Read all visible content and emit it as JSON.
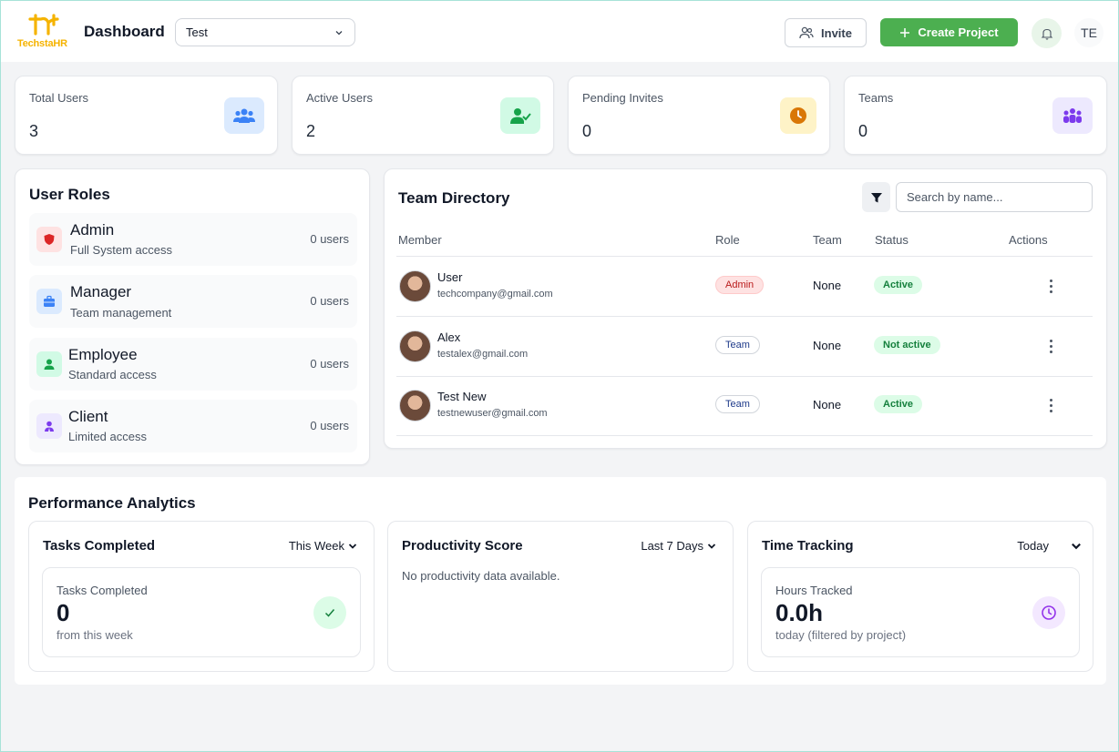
{
  "header": {
    "logo_text": "TechstaHR",
    "title": "Dashboard",
    "project_select": "Test",
    "invite_label": "Invite",
    "create_label": "Create Project",
    "avatar_initials": "TE"
  },
  "stats": [
    {
      "label": "Total Users",
      "value": "3",
      "icon": "users-icon",
      "color": "#3b82f6",
      "bg": "#dbeafe"
    },
    {
      "label": "Active Users",
      "value": "2",
      "icon": "user-check-icon",
      "color": "#16a34a",
      "bg": "#d1fae5"
    },
    {
      "label": "Pending Invites",
      "value": "0",
      "icon": "clock-icon",
      "color": "#d97706",
      "bg": "#fef3c7"
    },
    {
      "label": "Teams",
      "value": "0",
      "icon": "team-icon",
      "color": "#7c3aed",
      "bg": "#ede9fe"
    }
  ],
  "user_roles": {
    "title": "User Roles",
    "items": [
      {
        "name": "Admin",
        "desc": "Full System access",
        "count": "0 users",
        "icon": "shield-icon"
      },
      {
        "name": "Manager",
        "desc": "Team management",
        "count": "0 users",
        "icon": "briefcase-icon"
      },
      {
        "name": "Employee",
        "desc": "Standard access",
        "count": "0 users",
        "icon": "person-icon"
      },
      {
        "name": "Client",
        "desc": "Limited access",
        "count": "0 users",
        "icon": "client-icon"
      }
    ]
  },
  "directory": {
    "title": "Team Directory",
    "search_placeholder": "Search by name...",
    "columns": [
      "Member",
      "Role",
      "Team",
      "Status",
      "Actions"
    ],
    "rows": [
      {
        "name": "User",
        "email": "techcompany@gmail.com",
        "role": "Admin",
        "team": "None",
        "status": "Active"
      },
      {
        "name": "Alex",
        "email": "testalex@gmail.com",
        "role": "Team",
        "team": "None",
        "status": "Not active"
      },
      {
        "name": "Test New",
        "email": "testnewuser@gmail.com",
        "role": "Team",
        "team": "None",
        "status": "Active"
      }
    ]
  },
  "performance": {
    "title": "Performance Analytics",
    "tasks": {
      "title": "Tasks Completed",
      "range": "This Week",
      "label": "Tasks Completed",
      "value": "0",
      "sub": "from this week"
    },
    "productivity": {
      "title": "Productivity Score",
      "range": "Last 7 Days",
      "empty": "No productivity data available."
    },
    "time": {
      "title": "Time Tracking",
      "range": "Today",
      "label": "Hours Tracked",
      "value": "0.0h",
      "sub": "today (filtered by project)"
    }
  }
}
